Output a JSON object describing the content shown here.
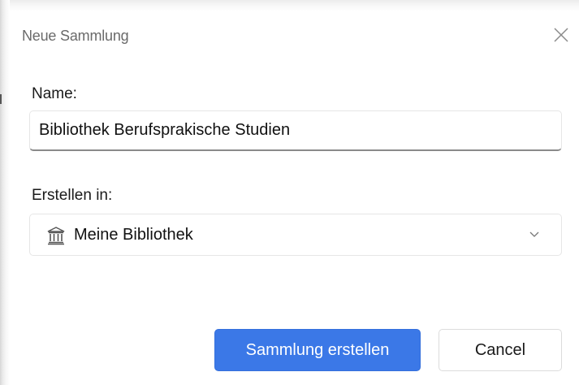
{
  "dialog": {
    "title": "Neue Sammlung",
    "close_icon": "close-icon"
  },
  "form": {
    "name_label": "Name:",
    "name_value": "Bibliothek Berufsprakische Studien",
    "location_label": "Erstellen in:",
    "location_value": "Meine Bibliothek",
    "location_icon": "library-icon",
    "dropdown_icon": "chevron-down-icon"
  },
  "actions": {
    "create_label": "Sammlung erstellen",
    "cancel_label": "Cancel"
  },
  "colors": {
    "primary": "#3b78e7",
    "title_text": "#6a6a6a",
    "text": "#1a1a1a"
  }
}
